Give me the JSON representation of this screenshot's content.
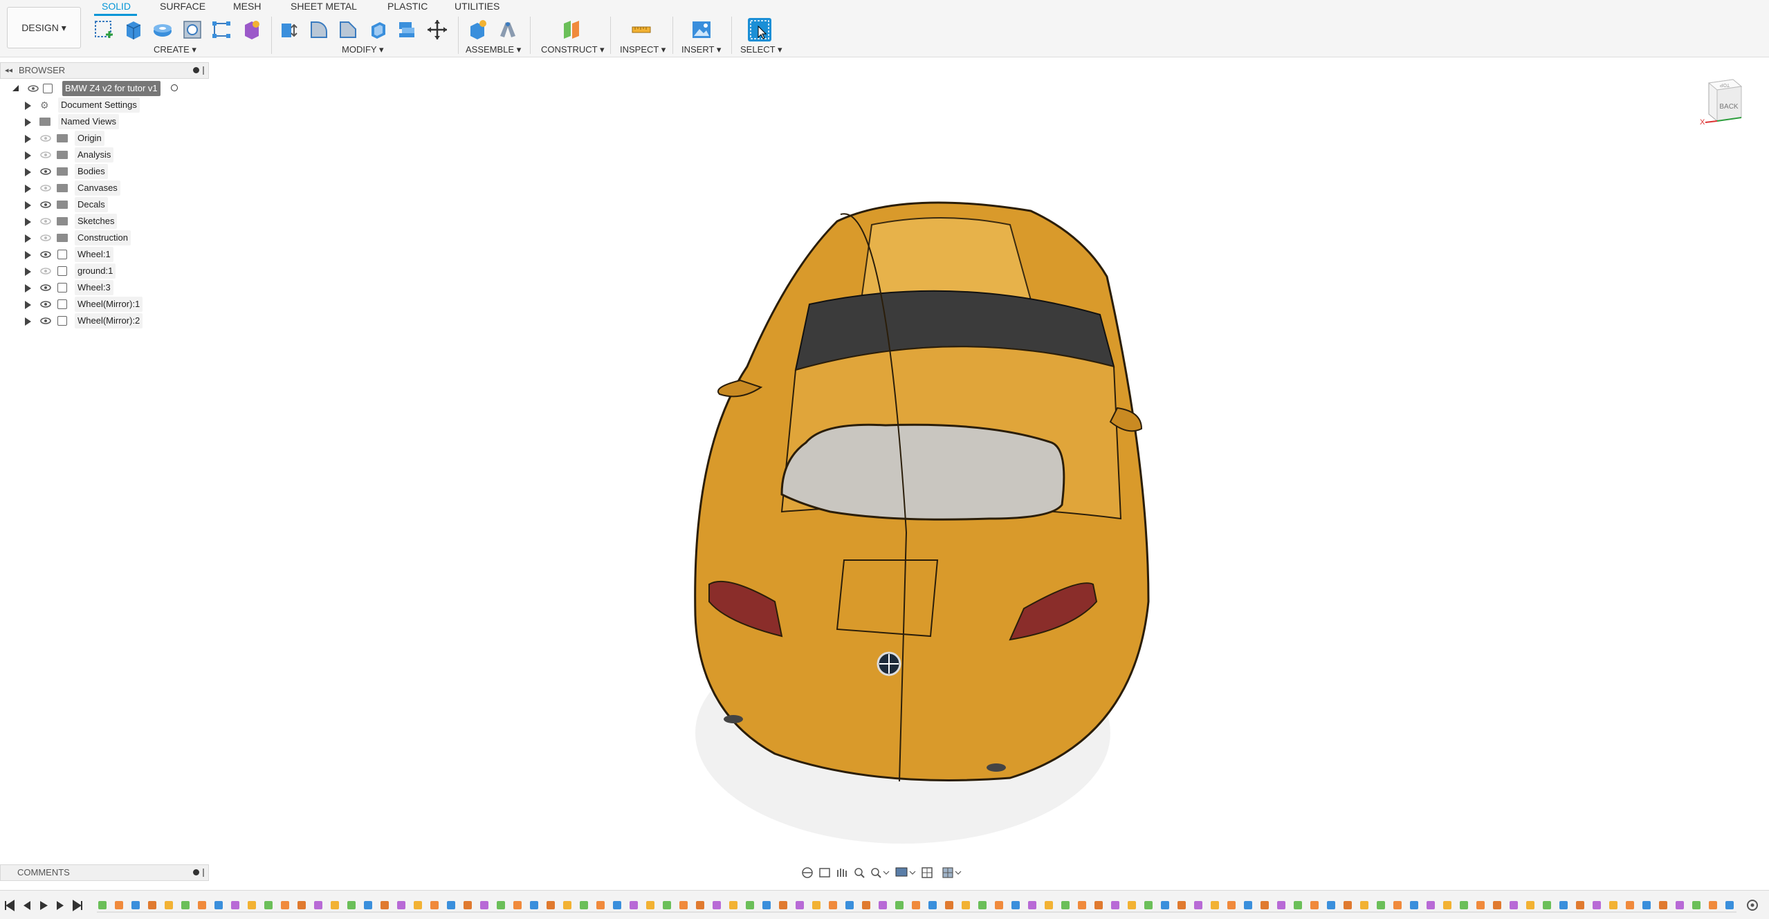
{
  "workspace": {
    "label": "DESIGN"
  },
  "tabs": [
    {
      "label": "SOLID",
      "active": true
    },
    {
      "label": "SURFACE"
    },
    {
      "label": "MESH"
    },
    {
      "label": "SHEET METAL"
    },
    {
      "label": "PLASTIC"
    },
    {
      "label": "UTILITIES"
    }
  ],
  "toolbar_groups": {
    "create": "CREATE",
    "modify": "MODIFY",
    "assemble": "ASSEMBLE",
    "construct": "CONSTRUCT",
    "inspect": "INSPECT",
    "insert": "INSERT",
    "select": "SELECT"
  },
  "browser": {
    "title": "BROWSER",
    "root": "BMW Z4 v2 for tutor v1",
    "items": [
      {
        "label": "Document Settings",
        "icon": "gear-icon"
      },
      {
        "label": "Named Views",
        "icon": "folder-icon"
      },
      {
        "label": "Origin",
        "icon": "folder-icon"
      },
      {
        "label": "Analysis",
        "icon": "folder-icon"
      },
      {
        "label": "Bodies",
        "icon": "folder-icon"
      },
      {
        "label": "Canvases",
        "icon": "folder-icon"
      },
      {
        "label": "Decals",
        "icon": "folder-icon"
      },
      {
        "label": "Sketches",
        "icon": "folder-icon"
      },
      {
        "label": "Construction",
        "icon": "folder-icon"
      },
      {
        "label": "Wheel:1",
        "icon": "component-icon"
      },
      {
        "label": "ground:1",
        "icon": "component-icon"
      },
      {
        "label": "Wheel:3",
        "icon": "component-icon"
      },
      {
        "label": "Wheel(Mirror):1",
        "icon": "component-icon"
      },
      {
        "label": "Wheel(Mirror):2",
        "icon": "component-icon"
      }
    ]
  },
  "comments": {
    "title": "COMMENTS"
  },
  "viewcube": {
    "face": "BACK",
    "top": "TOP",
    "axis": "X"
  },
  "colors": {
    "accent": "#0696d7",
    "car_body": "#d99a2b"
  }
}
